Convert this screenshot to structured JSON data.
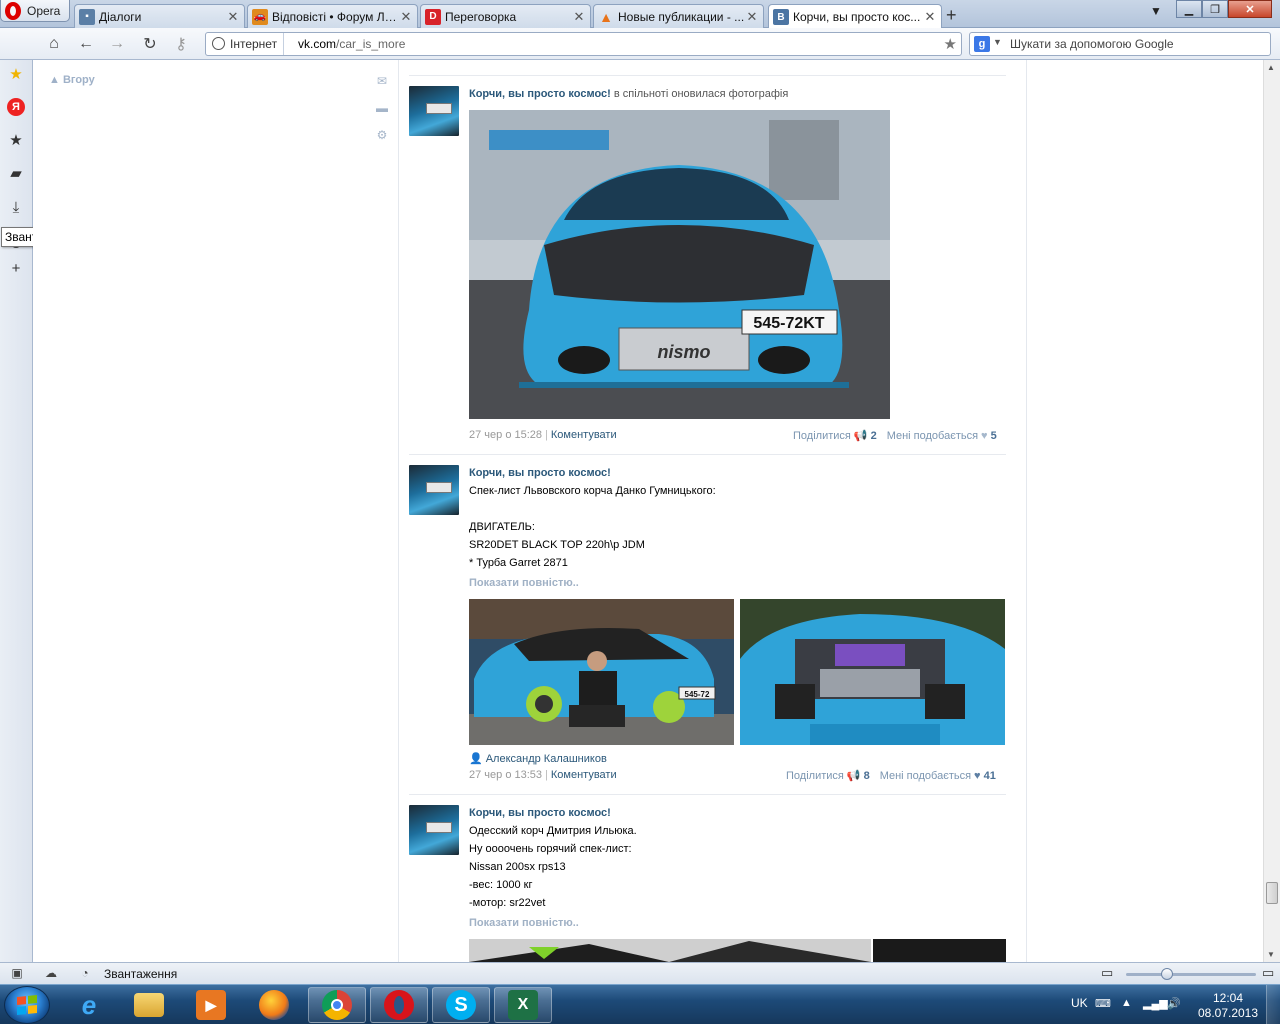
{
  "browser": {
    "menu_label": "Opera",
    "tabs": [
      {
        "title": "Діалоги",
        "favicon": "vk-dialog-icon"
      },
      {
        "title": "Відповісті • Форум Ль...",
        "favicon": "car-icon"
      },
      {
        "title": "Переговорка",
        "favicon": "d-logo-icon"
      },
      {
        "title": "Новые публикации - ...",
        "favicon": "cone-icon"
      },
      {
        "title": "Корчи, вы просто кос...",
        "favicon": "vk-logo-icon"
      }
    ],
    "security_label": "Інтернет",
    "url_host": "vk.com",
    "url_path": "/car_is_more",
    "search_placeholder": "Шукати за допомогою Google",
    "search_engine_letter": "g",
    "tooltip": "Звантаження",
    "status_text": "Звантаження"
  },
  "page": {
    "up_link": "Вгору",
    "posts": [
      {
        "author": "Корчи, вы просто космос!",
        "author_note": "в спільноті оновилася фотографія",
        "meta_time": "27 чер о 15:28",
        "comment_label": "Коментувати",
        "share_label": "Поділитися",
        "share_count": "2",
        "like_label": "Мені подобається",
        "like_count": "5"
      },
      {
        "author": "Корчи, вы просто космос!",
        "lines": [
          "Спек-лист Львовского корча Данко Гумницького:",
          "",
          "ДВИГАТЕЛЬ:",
          "SR20DET BLACK TOP 220h\\p JDM",
          "* Турба Garret 2871"
        ],
        "more_label": "Показати повністю..",
        "photo_credit": "Александр Калашников",
        "meta_time": "27 чер о 13:53",
        "comment_label": "Коментувати",
        "share_label": "Поділитися",
        "share_count": "8",
        "like_label": "Мені подобається",
        "like_count": "41"
      },
      {
        "author": "Корчи, вы просто космос!",
        "lines": [
          "Одесский корч Дмитрия Ильюка.",
          "Ну оооочень горячий спек-лист:",
          "Nissan 200sx rps13",
          "-вес: 1000 кг",
          "-мотор: sr22vet"
        ],
        "more_label": "Показати повністю.."
      }
    ],
    "plates": {
      "post1": "545-72KT",
      "post2": "545-72"
    }
  },
  "taskbar": {
    "lang": "UK",
    "time": "12:04",
    "date": "08.07.2013"
  },
  "colors": {
    "vk_link": "#2b587a",
    "vk_muted": "#a0b1c5",
    "car_blue": "#2fa3d8"
  }
}
